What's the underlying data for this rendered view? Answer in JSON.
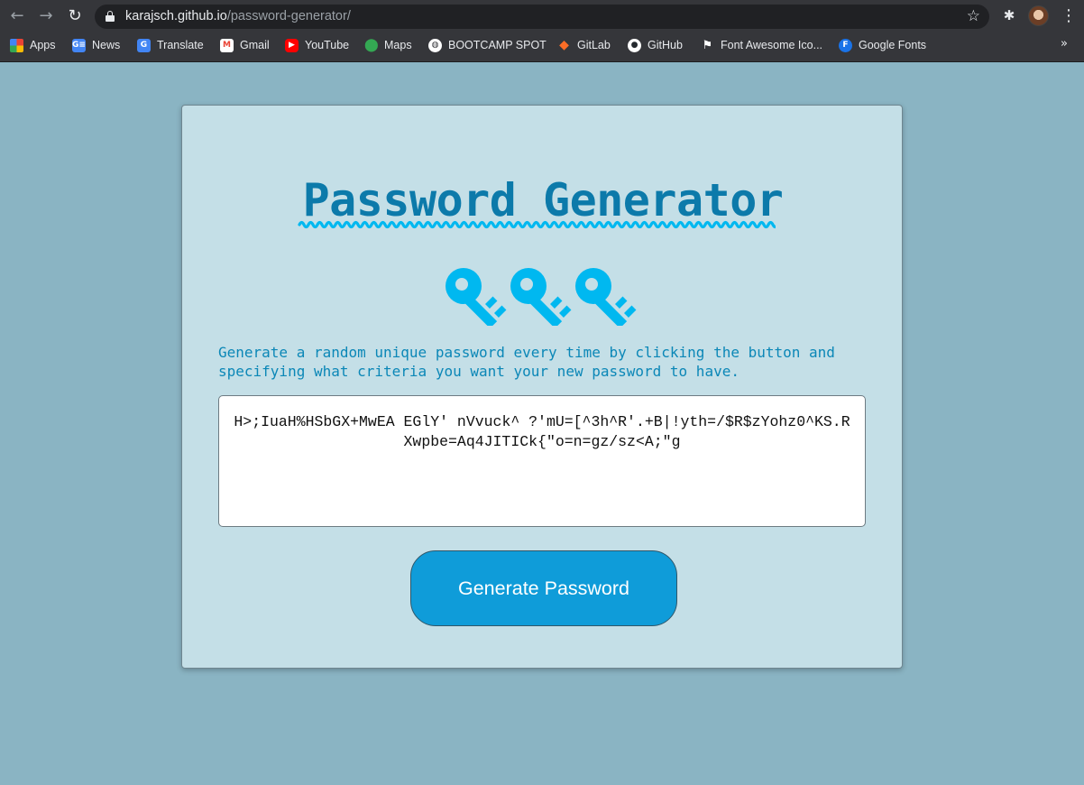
{
  "browser": {
    "url_host": "karajsch.github.io",
    "url_path": "/password-generator/",
    "nav": {
      "back_icon": "←",
      "forward_icon": "→",
      "reload_icon": "↻",
      "star_icon": "☆",
      "extensions_icon": "✱",
      "menu_icon": "⋮",
      "more_bookmarks_icon": "»"
    },
    "bookmarks": [
      {
        "label": "Apps",
        "icon": "apps-grid-icon"
      },
      {
        "label": "News",
        "icon": "google-news-icon",
        "glyph": "G≡"
      },
      {
        "label": "Translate",
        "icon": "google-translate-icon",
        "glyph": "G"
      },
      {
        "label": "Gmail",
        "icon": "gmail-icon",
        "glyph": "M"
      },
      {
        "label": "YouTube",
        "icon": "youtube-icon",
        "glyph": "▶"
      },
      {
        "label": "Maps",
        "icon": "maps-pin-icon",
        "glyph": "⬤"
      },
      {
        "label": "BOOTCAMP SPOT",
        "icon": "globe-icon",
        "glyph": "◍"
      },
      {
        "label": "GitLab",
        "icon": "gitlab-icon",
        "glyph": "◆"
      },
      {
        "label": "GitHub",
        "icon": "github-icon",
        "glyph": "●"
      },
      {
        "label": "Font Awesome Ico...",
        "icon": "flag-icon",
        "glyph": "⚑"
      },
      {
        "label": "Google Fonts",
        "icon": "google-fonts-icon",
        "glyph": "F"
      }
    ]
  },
  "page": {
    "title": "Password Generator",
    "icon": "keys-icon",
    "description": "Generate a random unique password every time by clicking the button and specifying what criteria you want your new password to have.",
    "password_value": "H>;IuaH%HSbGX+MwEA EGlY' nVvuck^ ?'mU=[^3h^R'.+B|!yth=/$R$zYohz0^KS.RXwpbe=Aq4JITICk{\"o=n=gz/sz<A;\"g",
    "button_label": "Generate Password"
  },
  "colors": {
    "background": "#8ab4c3",
    "card": "#c4dfe7",
    "title": "#0c7aaa",
    "accent": "#00b8f0",
    "button": "#0f9cd9"
  }
}
